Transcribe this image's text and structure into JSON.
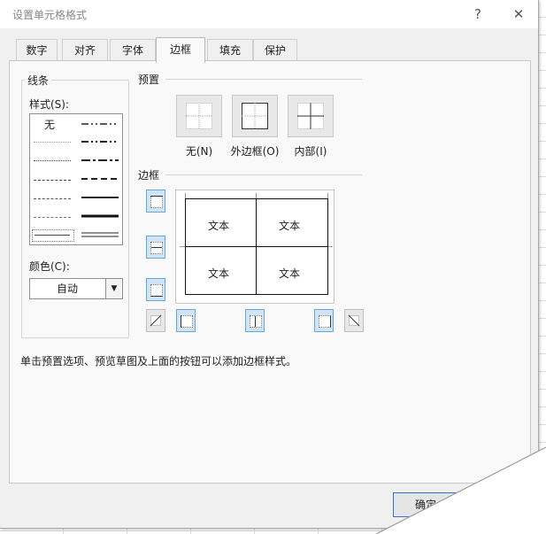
{
  "dialog": {
    "title": "设置单元格格式",
    "help": "?",
    "close": "✕"
  },
  "tabs": [
    "数字",
    "对齐",
    "字体",
    "边框",
    "填充",
    "保护"
  ],
  "line": {
    "group_title": "线条",
    "style_label": "样式(S):",
    "none_label": "无",
    "color_label": "颜色(C):",
    "color_value": "自动"
  },
  "presets": {
    "title": "预置",
    "items": [
      "无(N)",
      "外边框(O)",
      "内部(I)"
    ]
  },
  "border": {
    "title": "边框",
    "preview_text": [
      "文本",
      "文本",
      "文本",
      "文本"
    ]
  },
  "hint": "单击预置选项、预览草图及上面的按钮可以添加边框样式。",
  "ok_button": "确定",
  "colors": {
    "accent": "#2d74cc",
    "toggle_on": "#cfe5f5"
  }
}
